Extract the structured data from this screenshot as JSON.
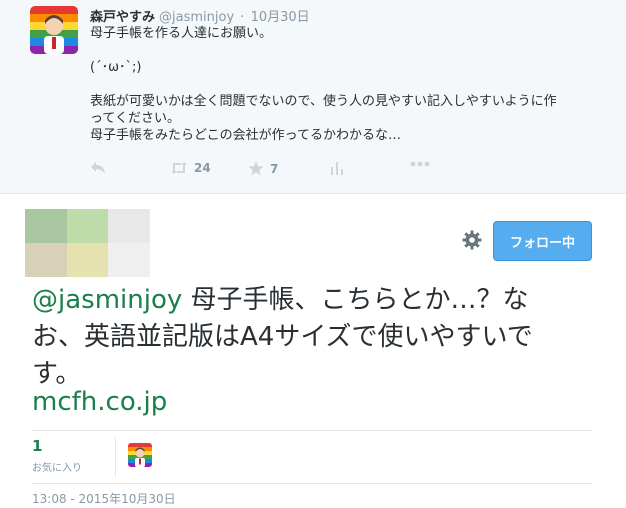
{
  "colors": {
    "accent": "#55acee",
    "link": "#1a7f4b",
    "muted": "#8899a6"
  },
  "parent_tweet": {
    "name": "森戸やすみ",
    "handle": "@jasminjoy",
    "separator": "·",
    "date": "10月30日",
    "lines": [
      "母子手帳を作る人達にお願い。",
      "",
      "(´･ω･`;)",
      "",
      "表紙が可愛いかは全く問題でないので、使う人の見やすい記入しやすいように作",
      "ってください。",
      "母子手帳をみたらどこの会社が作ってるかわかるな…"
    ],
    "actions": {
      "reply_icon": "reply-icon",
      "retweet_icon": "retweet-icon",
      "retweet_count": "24",
      "favorite_icon": "star-icon",
      "favorite_count": "7",
      "analytics_icon": "analytics-icon",
      "more_icon": "more-icon"
    }
  },
  "main_tweet": {
    "follow_label": "フォロー中",
    "settings_icon": "gear-icon",
    "mention": "@jasminjoy",
    "line1_rest": " 母子手帳、こちらとか…？な",
    "line2": "お、英語並記版はA4サイズで使いやすいで",
    "line3": "す。",
    "link": "mcfh.co.jp",
    "favorites_count": "1",
    "favorites_label": "お気に入り",
    "timestamp": "13:08 - 2015年10月30日"
  }
}
